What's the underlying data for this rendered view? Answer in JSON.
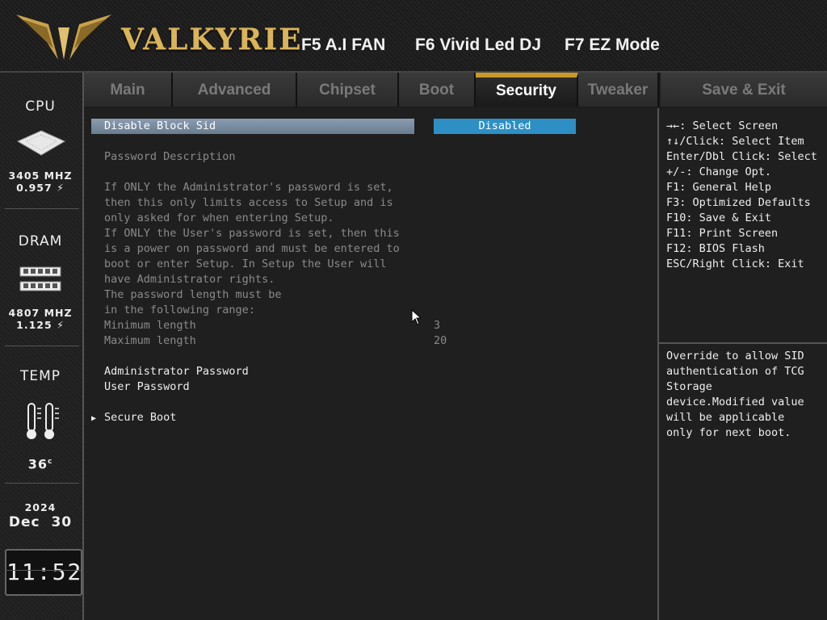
{
  "header": {
    "brand": "VALKYRIE",
    "fkeys": [
      "F5 A.I FAN",
      "F6 Vivid Led DJ",
      "F7 EZ Mode"
    ]
  },
  "sidebar": {
    "cpu": {
      "title": "CPU",
      "freq": "3405 MHZ",
      "volt": "0.957"
    },
    "dram": {
      "title": "DRAM",
      "freq": "4807 MHZ",
      "volt": "1.125"
    },
    "temp": {
      "title": "TEMP",
      "value": "36",
      "unit": "c"
    },
    "date": {
      "year": "2024",
      "month": "Dec",
      "day": "30"
    },
    "time": "11:52"
  },
  "tabs": [
    "Main",
    "Advanced",
    "Chipset",
    "Boot",
    "Security",
    "Tweaker"
  ],
  "active_tab": "Security",
  "save_exit": "Save & Exit",
  "main": {
    "selected_item": {
      "label": "Disable Block Sid",
      "value": "Disabled"
    },
    "password_title": "Password Description",
    "desc_lines": [
      "If ONLY the Administrator's password is set,",
      "then this only limits access to Setup and is",
      "only asked for when entering Setup.",
      "If ONLY the User's password is set, then this",
      "is a power on password and must be entered to",
      "boot or enter Setup. In Setup the User will",
      "have Administrator rights.",
      "The password length must be",
      "in the following range:"
    ],
    "min_label": "Minimum length",
    "min_value": "3",
    "max_label": "Maximum length",
    "max_value": "20",
    "admin_password": "Administrator Password",
    "user_password": "User Password",
    "secure_boot": "Secure Boot"
  },
  "help": {
    "keys": [
      "→←: Select Screen",
      "↑↓/Click: Select Item",
      "Enter/Dbl Click: Select",
      "+/-: Change Opt.",
      "F1: General Help",
      "F3: Optimized Defaults",
      "F10: Save & Exit",
      "F11: Print Screen",
      "F12: BIOS Flash",
      "ESC/Right Click: Exit"
    ],
    "description_lines": [
      "Override to allow SID",
      "authentication of TCG",
      "Storage",
      "device.Modified value",
      "will be applicable",
      "only for next boot."
    ]
  },
  "colors": {
    "accent": "#c8992a",
    "selected": "#2e8fc4"
  }
}
